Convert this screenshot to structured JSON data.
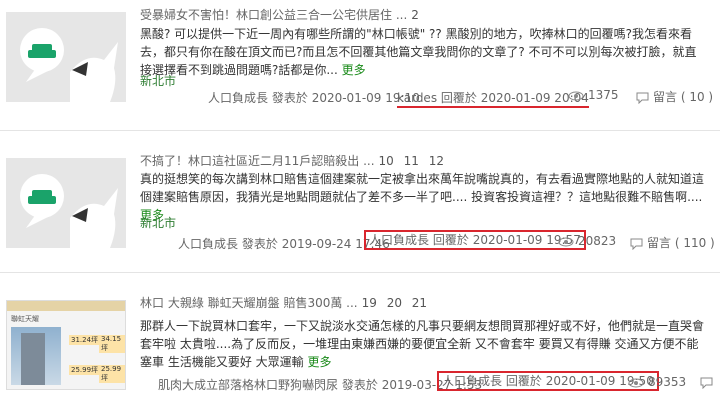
{
  "posts": [
    {
      "title": "受暴婦女不害怕！林口創公益三合一公宅供居住 ...",
      "pages": "2",
      "body": "黑酸? 可以提供一下近一周內有哪些所謂的\"林口帳號\" ?? 黑酸別的地方，吹捧林口的回覆嗎?我怎看來看去，都只有你在酸在頂文而已?而且怎不回覆其他篇文章我問你的文章了? 不可不可以別每次被打臉，就直接選擇看不到跳過問題嗎?話都是你...",
      "more": "更多",
      "location": "新北市",
      "author": "人口負成長",
      "posted_label": "發表於",
      "posted_date": "2020-01-09 19:10",
      "replier": "kardes",
      "reply_label": "回覆於",
      "reply_date": "2020-01-09 20:04",
      "views": "1375",
      "replies_label": "留言",
      "replies": "( 10 )"
    },
    {
      "title": "不搞了！林口這社區近二月11戶認賠殺出 ...",
      "pages": "10 11 12",
      "body": "真的挺想笑的每次講到林口賠售這個建案就一定被拿出來萬年說嘴說真的，有去看過實際地點的人就知道這個建案賠售原因，我猜光是地點問題就佔了差不多一半了吧.... 投資客投資這裡？？這地點很難不賠售啊....",
      "more": "更多",
      "location": "新北市",
      "author": "人口負成長",
      "posted_label": "發表於",
      "posted_date": "2019-09-24 17:46",
      "replier": "人口負成長",
      "reply_label": "回覆於",
      "reply_date": "2020-01-09 19:57",
      "views": "20823",
      "replies_label": "留言",
      "replies": "( 110 )"
    },
    {
      "title": "林口 大親綠 聯虹天耀崩盤 賠售300萬 ...",
      "pages": "19 20 21",
      "body": "那群人一下說買林口套牢，一下又說淡水交通怎樣的凡事只要網友想問買那裡好或不好，他們就是一直哭會套牢啦 太貴啦....為了反而反，一堆理由東嫌西嫌的要便宜全新 又不會套牢 要買又有得賺 交通又方便不能塞車 生活機能又要好 大眾運輸",
      "more": "更多",
      "author_prefix": "肌肉大成立部落格林口野狗嚇閃尿",
      "posted_label": "發表於",
      "posted_date": "2019-03-27 1:53",
      "replier": "人口負成長",
      "reply_label": "回覆於",
      "reply_date": "2020-01-09 19:50",
      "views": "89353",
      "thumb_name": "聯虹天耀",
      "thumb_prices": [
        "31.24坪",
        "34.15坪",
        "25.99坪",
        "25.99坪"
      ]
    }
  ],
  "colors": {
    "highlight": "#d9262e",
    "location": "#2e7d32",
    "more": "#1a8a1a"
  },
  "icons": {
    "thumb": "sofa-chat-icon",
    "views": "eye-icon",
    "replies": "comment-icon"
  }
}
